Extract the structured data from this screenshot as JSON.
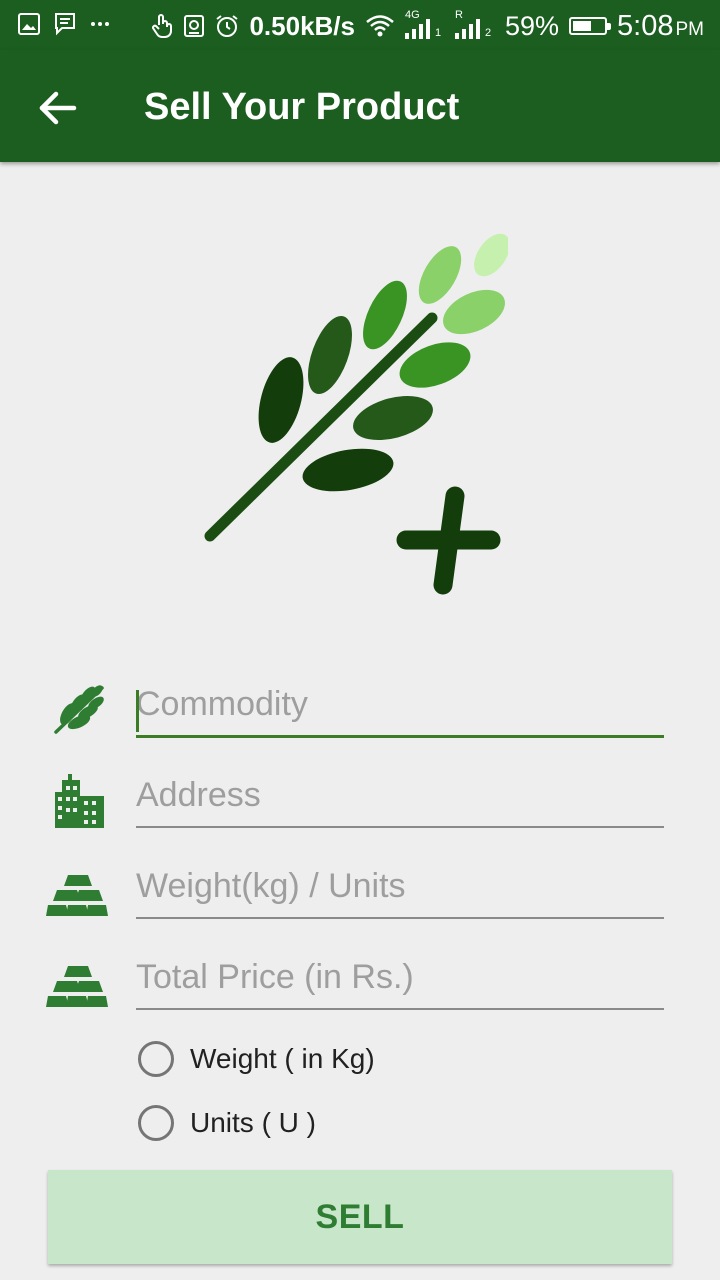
{
  "status_bar": {
    "net_speed": "0.50kB/s",
    "network_4g": "4G",
    "sim1": "1",
    "roaming": "R",
    "sim2": "2",
    "battery_percent": "59%",
    "battery_level": 0.59,
    "time": "5:08",
    "meridiem": "PM"
  },
  "app_bar": {
    "title": "Sell Your Product",
    "back_icon": "arrow-left-icon"
  },
  "hero": {
    "icon": "wheat-add-icon"
  },
  "form": {
    "commodity": {
      "placeholder": "Commodity",
      "value": "",
      "icon": "wheat-icon"
    },
    "address": {
      "placeholder": "Address",
      "value": "",
      "icon": "building-icon"
    },
    "weight": {
      "placeholder": "Weight(kg) / Units",
      "value": "",
      "icon": "gold-bars-icon"
    },
    "price": {
      "placeholder": "Total Price (in Rs.)",
      "value": "",
      "icon": "gold-bars-icon"
    }
  },
  "radio_options": [
    {
      "label": "Weight ( in Kg)",
      "selected": false
    },
    {
      "label": "Units ( U )",
      "selected": false
    }
  ],
  "sell_button": {
    "label": "SELL"
  },
  "colors": {
    "primary_dark": "#1b5e20",
    "accent": "#3a7d25",
    "button_bg": "#c8e6c9",
    "button_text": "#2e7d32",
    "background": "#eeeeee"
  }
}
